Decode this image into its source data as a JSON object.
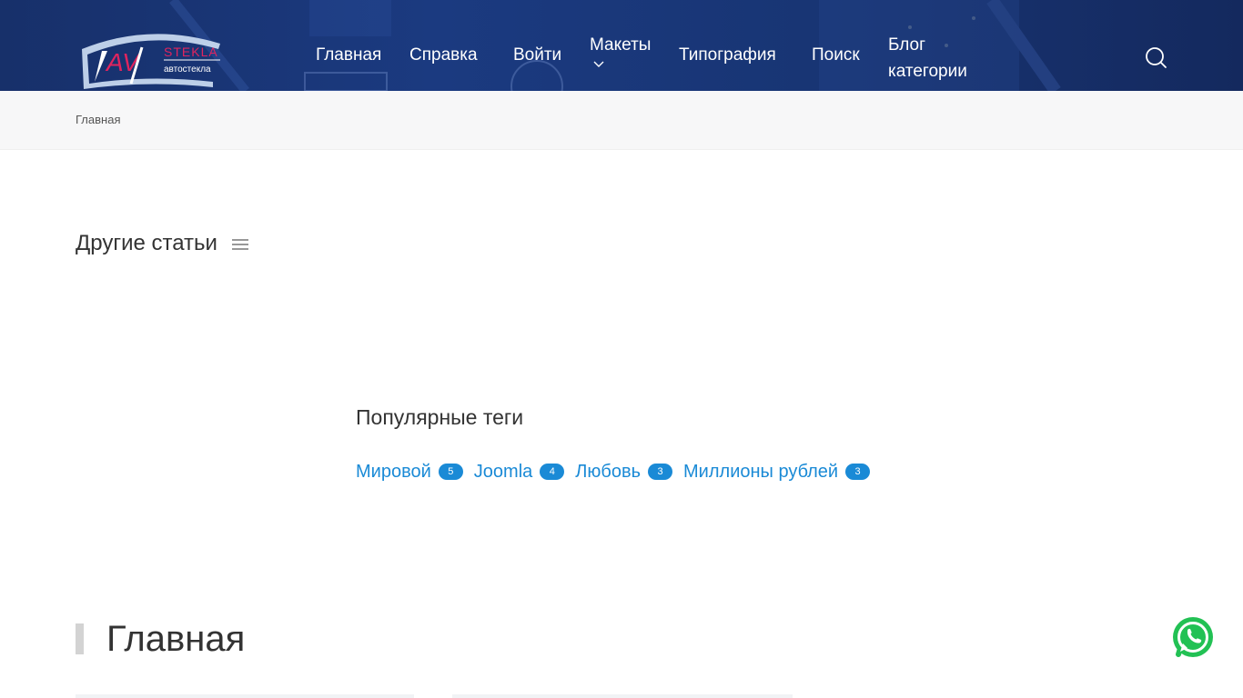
{
  "colors": {
    "header_bg": "#1b3a80",
    "link": "#1a8ad6",
    "whatsapp": "#22c154",
    "logo_accent": "#e0245e"
  },
  "logo": {
    "main_text": "AV",
    "top_text": "STEKLA",
    "sub_text": "автостекла"
  },
  "nav": {
    "items": [
      {
        "label": "Главная",
        "active": true
      },
      {
        "label": "Справка"
      },
      {
        "label": "Войти"
      },
      {
        "label": "Макеты",
        "has_dropdown": true
      },
      {
        "label": "Типография"
      },
      {
        "label": "Поиск"
      },
      {
        "label": "Блог категории"
      }
    ]
  },
  "breadcrumb": {
    "items": [
      "Главная"
    ]
  },
  "other_articles": {
    "title": "Другие статьи"
  },
  "popular_tags": {
    "title": "Популярные теги",
    "tags": [
      {
        "label": "Мировой",
        "count": "5"
      },
      {
        "label": "Joomla",
        "count": "4"
      },
      {
        "label": "Любовь",
        "count": "3"
      },
      {
        "label": "Миллионы рублей",
        "count": "3"
      }
    ]
  },
  "main": {
    "heading": "Главная"
  },
  "icons": {
    "search": "search-icon",
    "menu": "hamburger-icon",
    "dropdown": "chevron-down-icon",
    "whatsapp": "whatsapp-icon"
  }
}
